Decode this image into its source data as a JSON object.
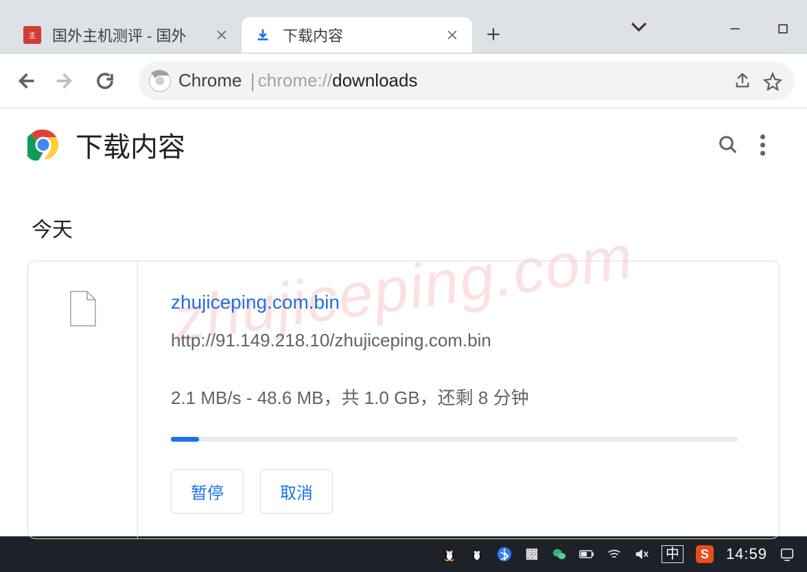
{
  "tabs": {
    "items": [
      {
        "title": "国外主机测评 - 国外"
      },
      {
        "title": "下载内容"
      }
    ]
  },
  "omnibox": {
    "context": "Chrome",
    "url_prefix": "chrome://",
    "url_highlight": "downloads"
  },
  "page": {
    "title": "下载内容",
    "today": "今天"
  },
  "download": {
    "filename": "zhujiceping.com.bin",
    "source_url": "http://91.149.218.10/zhujiceping.com.bin",
    "status": "2.1 MB/s - 48.6 MB，共 1.0 GB，还剩 8 分钟",
    "progress_percent": 5,
    "pause_label": "暂停",
    "cancel_label": "取消"
  },
  "watermark": "zhujiceping.com",
  "taskbar": {
    "ime": "中",
    "clock": "14:59",
    "sogou": "S"
  }
}
